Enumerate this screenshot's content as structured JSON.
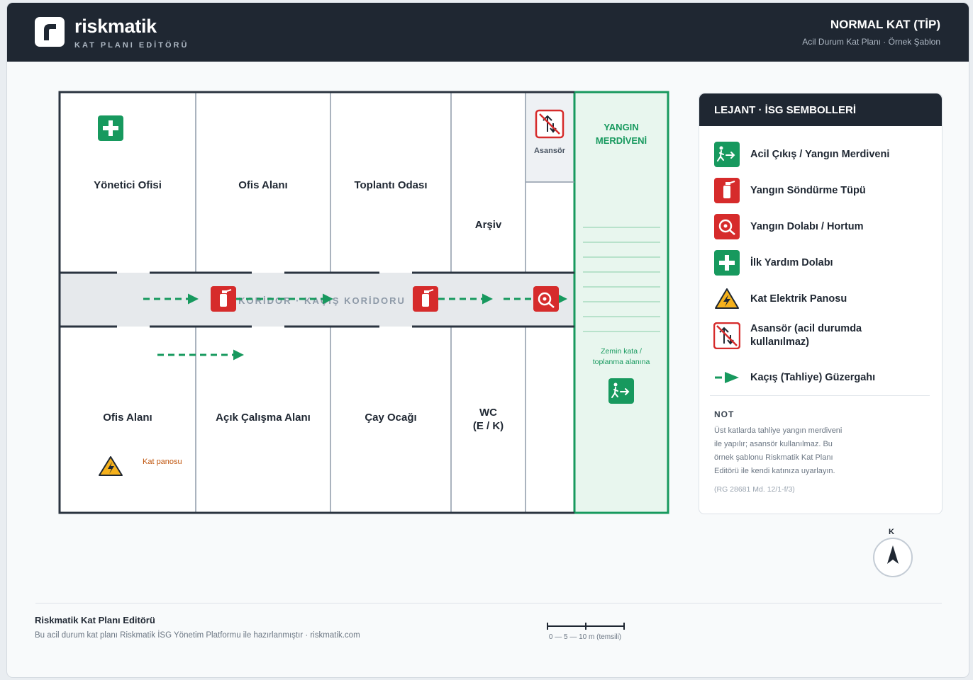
{
  "header": {
    "brand": "riskmatik",
    "brand_sub": "KAT PLANI EDİTÖRÜ",
    "title": "NORMAL KAT (TİP)",
    "subtitle": "Acil Durum Kat Planı · Örnek Şablon"
  },
  "plan": {
    "rooms_top": [
      "Yönetici Ofisi",
      "Ofis Alanı",
      "Toplantı Odası",
      "Arşiv"
    ],
    "rooms_bottom": [
      "Ofis Alanı",
      "Açık Çalışma Alanı",
      "Çay Ocağı"
    ],
    "wc_line1": "WC",
    "wc_line2": "(E / K)",
    "elevator": "Asansör",
    "stair_line1": "YANGIN",
    "stair_line2": "MERDİVENİ",
    "corridor": "KORİDOR · KAÇIŞ KORİDORU",
    "panel_note": "Kat panosu",
    "assembly_line1": "Zemin kata /",
    "assembly_line2": "toplanma alanına"
  },
  "legend": {
    "title": "LEJANT · İSG SEMBOLLERİ",
    "items": [
      {
        "label": "Acil Çıkış / Yangın Merdiveni",
        "icon": "emergency-exit-icon"
      },
      {
        "label": "Yangın Söndürme Tüpü",
        "icon": "fire-extinguisher-icon"
      },
      {
        "label": "Yangın Dolabı / Hortum",
        "icon": "fire-hose-icon"
      },
      {
        "label": "İlk Yardım Dolabı",
        "icon": "first-aid-icon"
      },
      {
        "label": "Kat Elektrik Panosu",
        "icon": "electrical-panel-icon"
      },
      {
        "label_line1": "Asansör (acil durumda",
        "label_line2": "kullanılmaz)",
        "icon": "no-elevator-icon"
      },
      {
        "label": "Kaçış (Tahliye) Güzergahı",
        "icon": "escape-route-arrow-icon"
      }
    ],
    "note_title": "NOT",
    "note_lines": [
      "Üst katlarda tahliye yangın merdiveni",
      "ile yapılır; asansör kullanılmaz. Bu",
      "örnek şablonu Riskmatik Kat Planı",
      "Editörü ile kendi katınıza uyarlayın."
    ],
    "note_ref": "(RG 28681 Md. 12/1-f/3)"
  },
  "compass": {
    "label": "K"
  },
  "footer": {
    "title": "Riskmatik Kat Planı Editörü",
    "subtitle": "Bu acil durum kat planı Riskmatik İSG Yönetim Platformu ile hazırlanmıştır · riskmatik.com",
    "scale": "0 — 5 — 10 m (temsili)"
  },
  "colors": {
    "safety_green": "#17995e",
    "fire_red": "#d62b2b",
    "dark": "#1f2732",
    "warning_yellow": "#f5b11c"
  }
}
